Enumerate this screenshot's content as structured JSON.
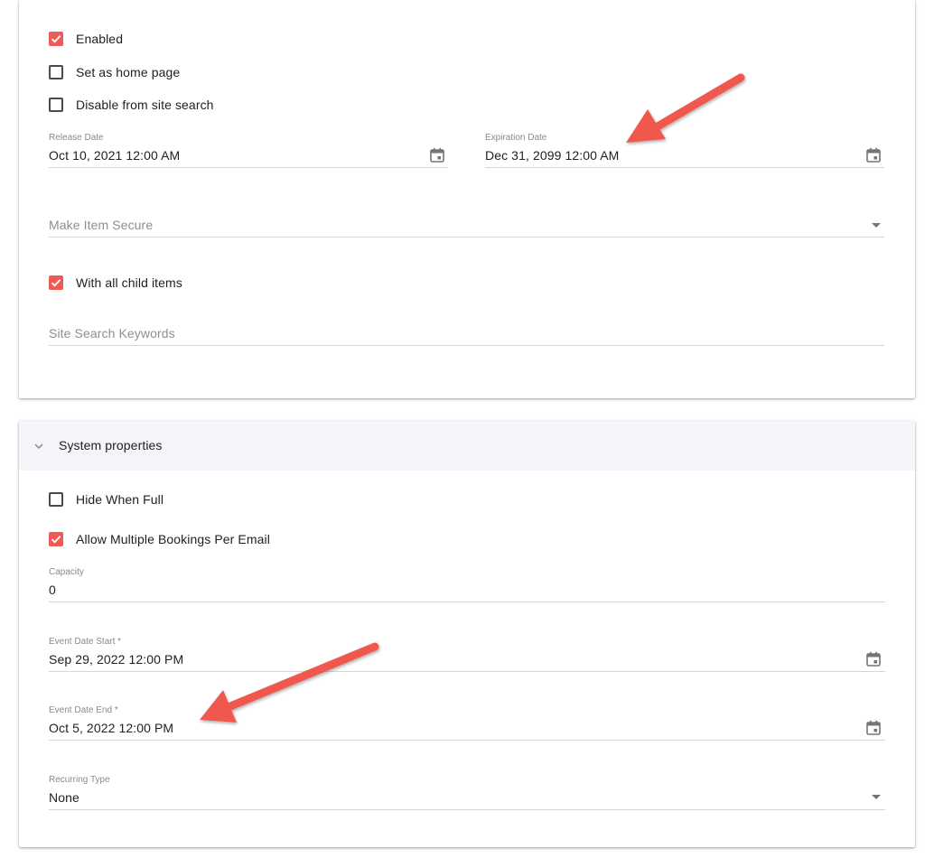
{
  "general": {
    "enabled": {
      "label": "Enabled",
      "checked": true
    },
    "home_page": {
      "label": "Set as home page",
      "checked": false
    },
    "disable_search": {
      "label": "Disable from site search",
      "checked": false
    },
    "release_date": {
      "label": "Release Date",
      "value": "Oct 10, 2021 12:00 AM"
    },
    "expiration_date": {
      "label": "Expiration Date",
      "value": "Dec 31, 2099 12:00 AM"
    },
    "make_secure": {
      "placeholder": "Make Item Secure"
    },
    "child_items": {
      "label": "With all child items",
      "checked": true
    },
    "search_keywords": {
      "placeholder": "Site Search Keywords"
    }
  },
  "system": {
    "title": "System properties",
    "hide_when_full": {
      "label": "Hide When Full",
      "checked": false
    },
    "allow_multiple": {
      "label": "Allow Multiple Bookings Per Email",
      "checked": true
    },
    "capacity": {
      "label": "Capacity",
      "value": "0"
    },
    "event_start": {
      "label": "Event Date Start *",
      "value": "Sep 29, 2022 12:00 PM"
    },
    "event_end": {
      "label": "Event Date End *",
      "value": "Oct 5, 2022 12:00 PM"
    },
    "recurring": {
      "label": "Recurring Type",
      "value": "None"
    }
  },
  "colors": {
    "accent": "#ee5b55",
    "panel_header": "#f4f5f8",
    "arrow": "#f0584e"
  },
  "icons": [
    "check-icon",
    "calendar-icon",
    "dropdown-caret-icon",
    "chevron-down-icon"
  ]
}
